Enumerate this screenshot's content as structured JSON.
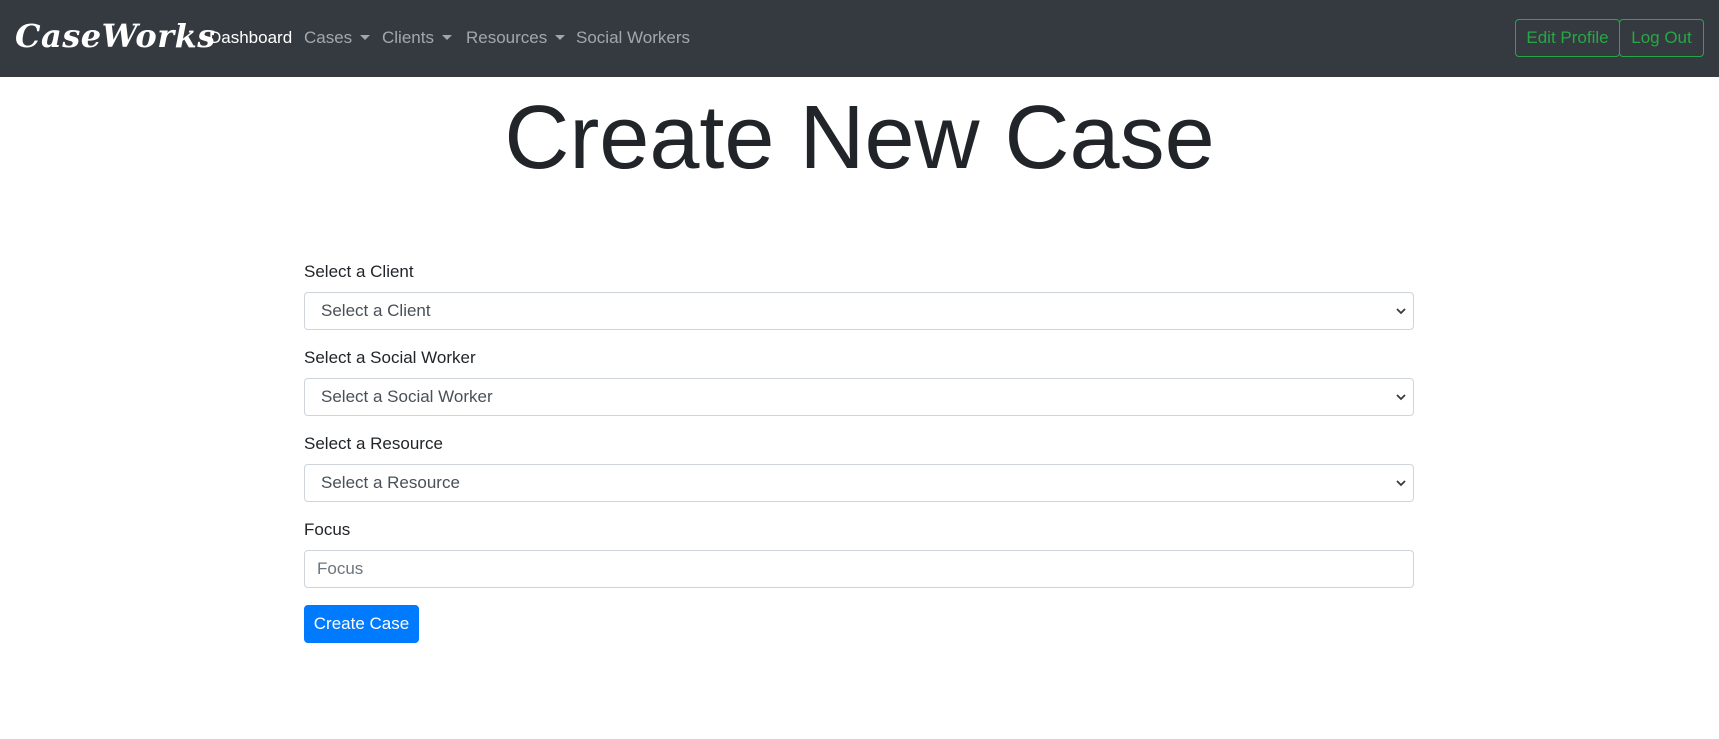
{
  "navbar": {
    "brand": "CaseWorks",
    "links": [
      {
        "label": "Dashboard"
      },
      {
        "label": "Cases"
      },
      {
        "label": "Clients"
      },
      {
        "label": "Resources"
      },
      {
        "label": "Social Workers"
      }
    ],
    "edit_profile_label": "Edit Profile",
    "logout_label": "Log Out"
  },
  "main": {
    "title": "Create New Case",
    "form": {
      "client": {
        "label": "Select a Client",
        "selected": "Select a Client"
      },
      "social_worker": {
        "label": "Select a Social Worker",
        "selected": "Select a Social Worker"
      },
      "resource": {
        "label": "Select a Resource",
        "selected": "Select a Resource"
      },
      "focus": {
        "label": "Focus",
        "placeholder": "Focus",
        "value": ""
      },
      "submit_label": "Create Case"
    }
  },
  "colors": {
    "navbar_bg": "#343a40",
    "accent_success": "#28a745",
    "primary": "#007bff"
  },
  "icons": {
    "dropdown": "caret-down-icon",
    "select": "chevron-down-icon"
  }
}
